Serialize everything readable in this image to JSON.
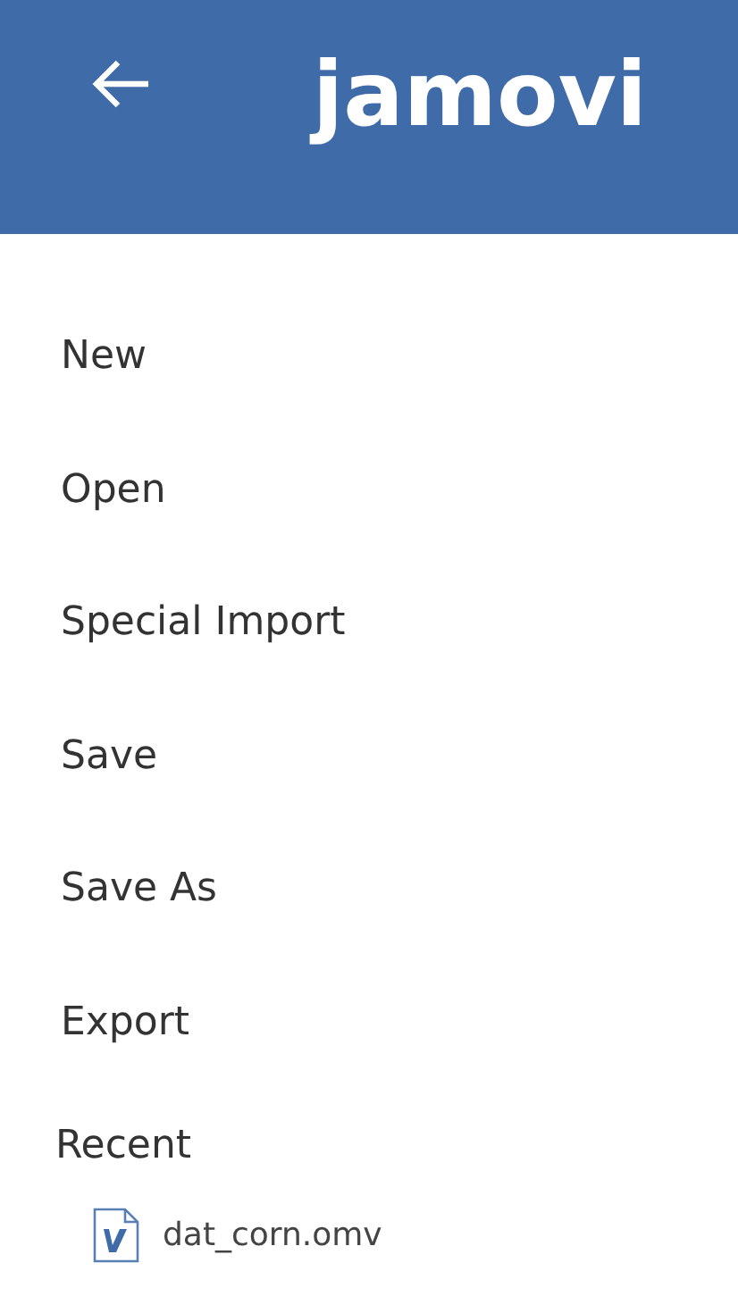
{
  "header": {
    "logo": "jamovi"
  },
  "menu": [
    {
      "label": "New"
    },
    {
      "label": "Open"
    },
    {
      "label": "Special Import"
    },
    {
      "label": "Save"
    },
    {
      "label": "Save As"
    },
    {
      "label": "Export"
    }
  ],
  "recent": {
    "title": "Recent",
    "files": [
      {
        "name": "dat_corn.omv"
      }
    ]
  }
}
